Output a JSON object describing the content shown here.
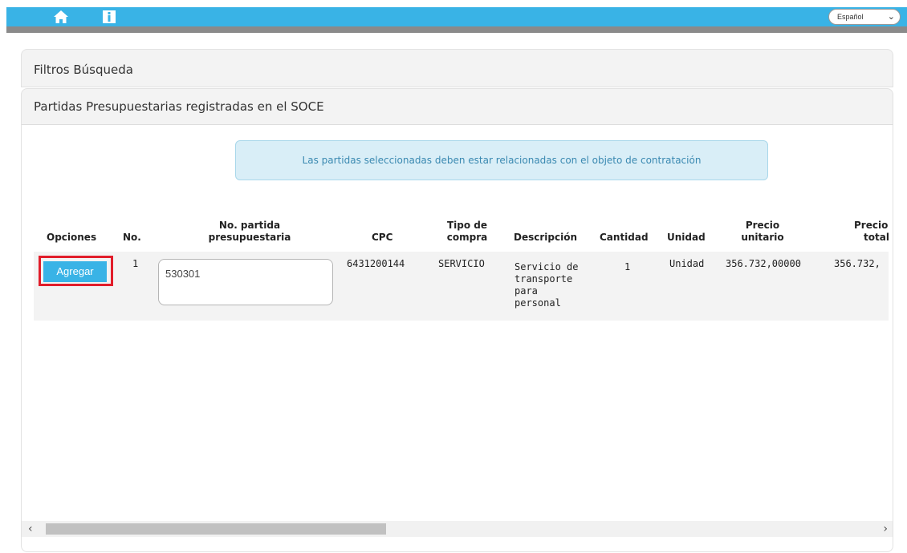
{
  "topbar": {
    "home_icon": "home-icon",
    "info_icon": "info-icon",
    "language": "Español",
    "accent": "#39b3e6"
  },
  "filters": {
    "title": "Filtros Búsqueda"
  },
  "partidas": {
    "title": "Partidas Presupuestarias registradas en el SOCE"
  },
  "alert": {
    "text": "Las partidas seleccionadas deben estar relacionadas con el objeto de contratación"
  },
  "table": {
    "headers": {
      "opciones": "Opciones",
      "no": "No.",
      "partida_1": "No. partida",
      "partida_2": "presupuestaria",
      "cpc": "CPC",
      "tipo_1": "Tipo de",
      "tipo_2": "compra",
      "descripcion": "Descripción",
      "cantidad": "Cantidad",
      "unidad": "Unidad",
      "precio_u_1": "Precio",
      "precio_u_2": "unitario",
      "precio_t_1": "Precio",
      "precio_t_2": "total"
    },
    "rows": [
      {
        "button": "Agregar",
        "no": "1",
        "partida": "530301",
        "cpc": "6431200144",
        "tipo": "SERVICIO",
        "descripcion": [
          "Servicio de",
          "transporte",
          "para",
          "personal"
        ],
        "cantidad": "1",
        "unidad": "Unidad",
        "precio_unitario": "356.732,00000",
        "precio_total": "356.732,"
      }
    ]
  }
}
